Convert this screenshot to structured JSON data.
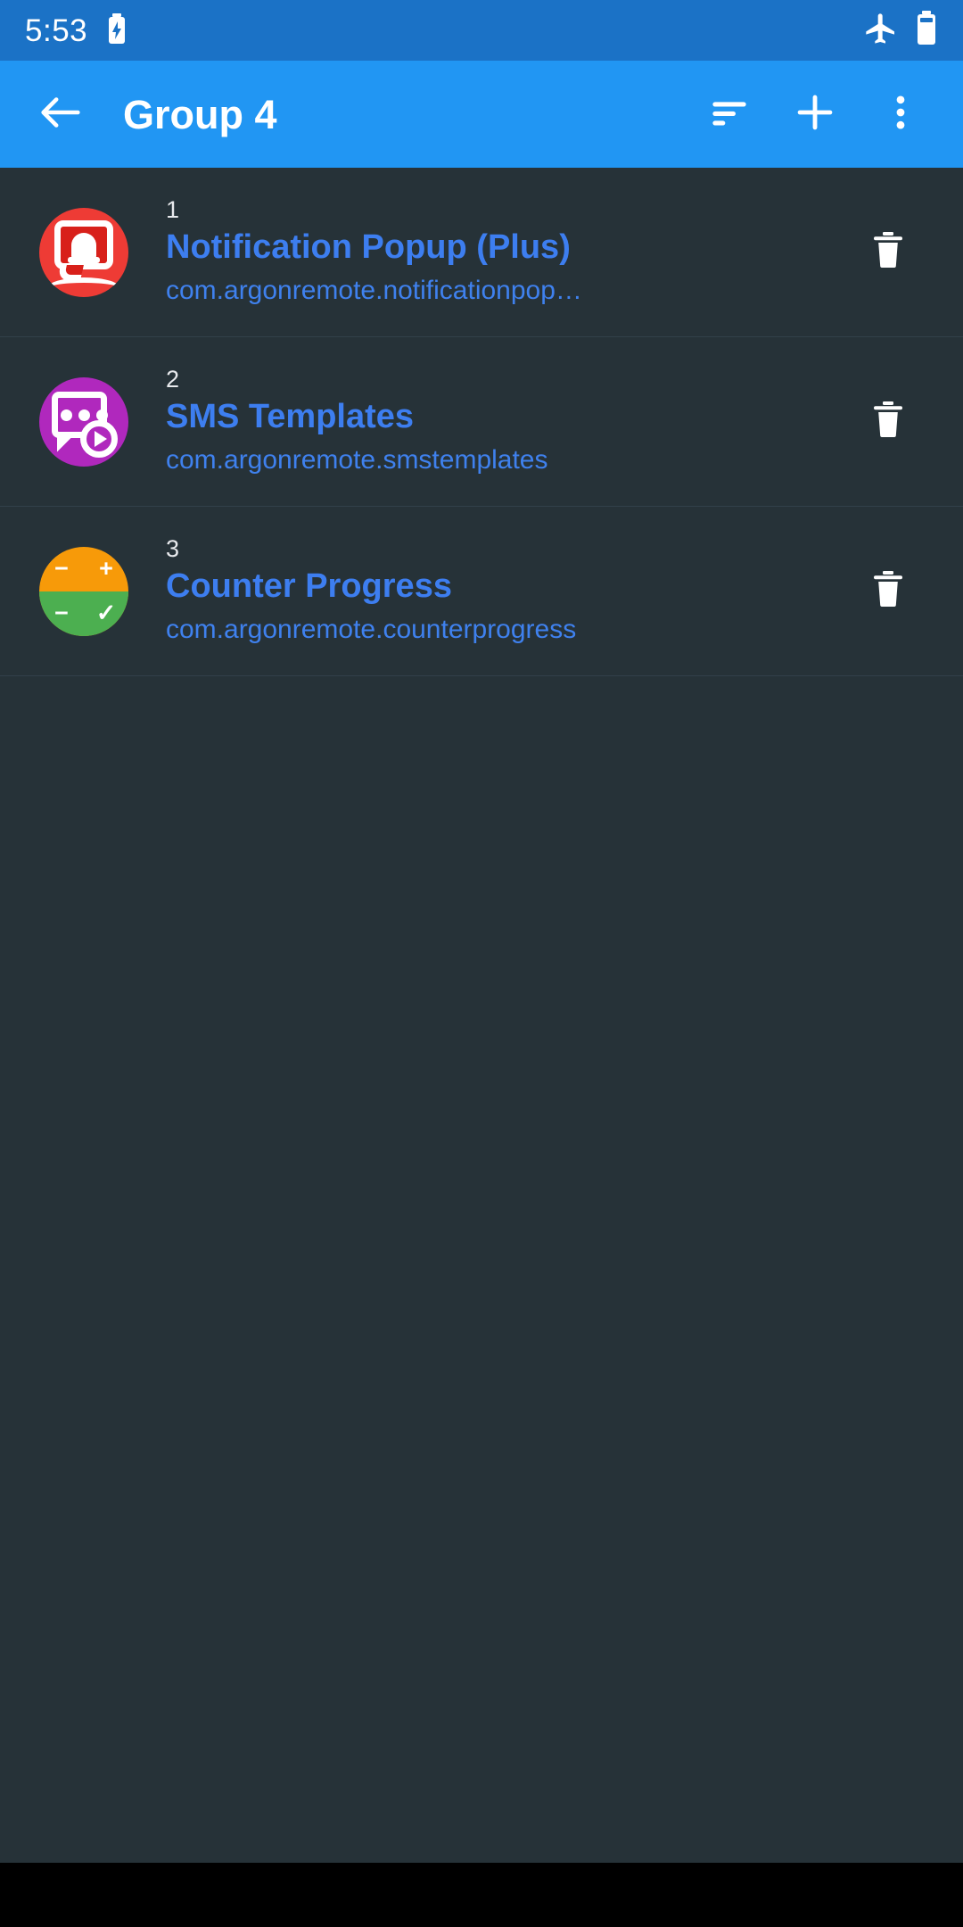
{
  "status_bar": {
    "clock": "5:53",
    "charging_icon": "battery-charging-icon",
    "airplane_icon": "airplane-mode-icon",
    "battery_icon": "battery-icon",
    "background_color": "#1b72c6"
  },
  "app_bar": {
    "back_icon": "back-arrow-icon",
    "title": "Group 4",
    "actions": [
      {
        "name": "sort-icon",
        "label": "Sort"
      },
      {
        "name": "add-icon",
        "label": "Add"
      },
      {
        "name": "overflow-menu-icon",
        "label": "More options"
      }
    ],
    "background_color": "#2196f3",
    "title_color": "#ffffff"
  },
  "app_list": {
    "title_color": "#3d7ef0",
    "subtitle_color": "#3f81ee",
    "row_background": "#263238",
    "items": [
      {
        "index": "1",
        "title": "Notification Popup (Plus)",
        "package": "com.argonremote.notificationpopuppl…",
        "icon_name": "notification-popup-app-icon",
        "icon_color": "#ee3b35",
        "delete_icon": "trash-icon"
      },
      {
        "index": "2",
        "title": "SMS Templates",
        "package": "com.argonremote.smstemplates",
        "icon_name": "sms-templates-app-icon",
        "icon_color": "#b028bd",
        "delete_icon": "trash-icon"
      },
      {
        "index": "3",
        "title": "Counter Progress",
        "package": "com.argonremote.counterprogress",
        "icon_name": "counter-progress-app-icon",
        "icon_color": "#f79a09",
        "icon_color_secondary": "#4caf50",
        "glyphs": [
          "−",
          "+",
          "−",
          "✓"
        ],
        "delete_icon": "trash-icon"
      }
    ]
  },
  "nav_bar": {
    "background_color": "#000000"
  }
}
